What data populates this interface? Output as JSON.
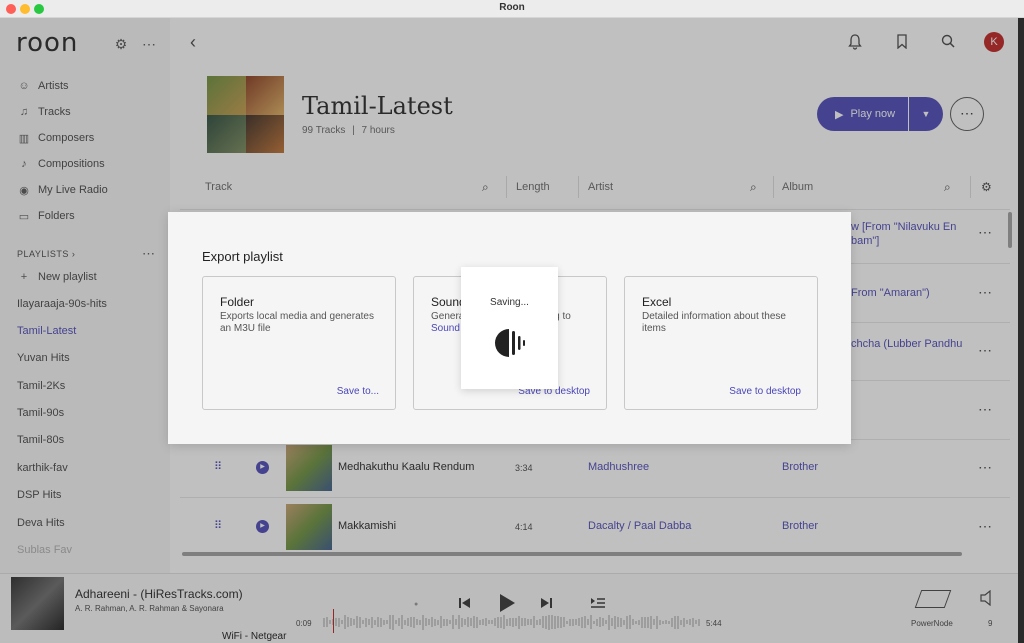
{
  "window": {
    "title": "Roon"
  },
  "sidebar": {
    "logo": "roon",
    "nav": [
      {
        "label": "Artists",
        "icon": "artist-icon"
      },
      {
        "label": "Tracks",
        "icon": "music-note-icon"
      },
      {
        "label": "Composers",
        "icon": "composer-icon"
      },
      {
        "label": "Compositions",
        "icon": "composition-icon"
      },
      {
        "label": "My Live Radio",
        "icon": "radio-icon"
      },
      {
        "label": "Folders",
        "icon": "folder-icon"
      }
    ],
    "playlists_header": "PLAYLISTS ›",
    "new_playlist": "New playlist",
    "playlists": [
      "Ilayaraaja-90s-hits",
      "Tamil-Latest",
      "Yuvan Hits",
      "Tamil-2Ks",
      "Tamil-90s",
      "Tamil-80s",
      "karthik-fav",
      "DSP Hits",
      "Deva Hits",
      "Sublas Fav"
    ],
    "active_playlist": "Tamil-Latest"
  },
  "playlist": {
    "title": "Tamil-Latest",
    "tracks_count": "99 Tracks",
    "duration": "7 hours",
    "separator": "|",
    "play_now": "Play now"
  },
  "table": {
    "headers": {
      "track": "Track",
      "length": "Length",
      "artist": "Artist",
      "album": "Album"
    },
    "partial_albums": [
      "w [From \"Nilavuku En",
      "bam\"]",
      "From \"Amaran\")",
      "chcha (Lubber Pandhu"
    ],
    "rows": [
      {
        "name": "Medhakuthu Kaalu Rendum",
        "length": "3:34",
        "artist": "Madhushree",
        "album": "Brother"
      },
      {
        "name": "Makkamishi",
        "length": "4:14",
        "artist": "Dacalty / Paal Dabba",
        "album": "Brother"
      }
    ]
  },
  "modal": {
    "title": "Export playlist",
    "cards": [
      {
        "title": "Folder",
        "desc": "Exports local media and generates an M3U file",
        "action": "Save to..."
      },
      {
        "title": "Sound",
        "desc_a": "Genera",
        "desc_b": "ing to",
        "desc_link": "Sound",
        "action": "Save to desktop"
      },
      {
        "title": "Excel",
        "desc": "Detailed information about these items",
        "action": "Save to desktop"
      }
    ],
    "saving": "Saving..."
  },
  "now_playing": {
    "title": "Adhareeni - (HiResTracks.com)",
    "artists": "A. R. Rahman, A. R. Rahman & Sayonara",
    "elapsed": "0:09",
    "total": "5:44",
    "zone": "PowerNode",
    "volume": "9"
  },
  "status": {
    "wifi": "WiFi - Netgear"
  },
  "colors": {
    "accent": "#4a47b8",
    "avatar": "#c21e1e"
  },
  "avatar_letter": "K"
}
